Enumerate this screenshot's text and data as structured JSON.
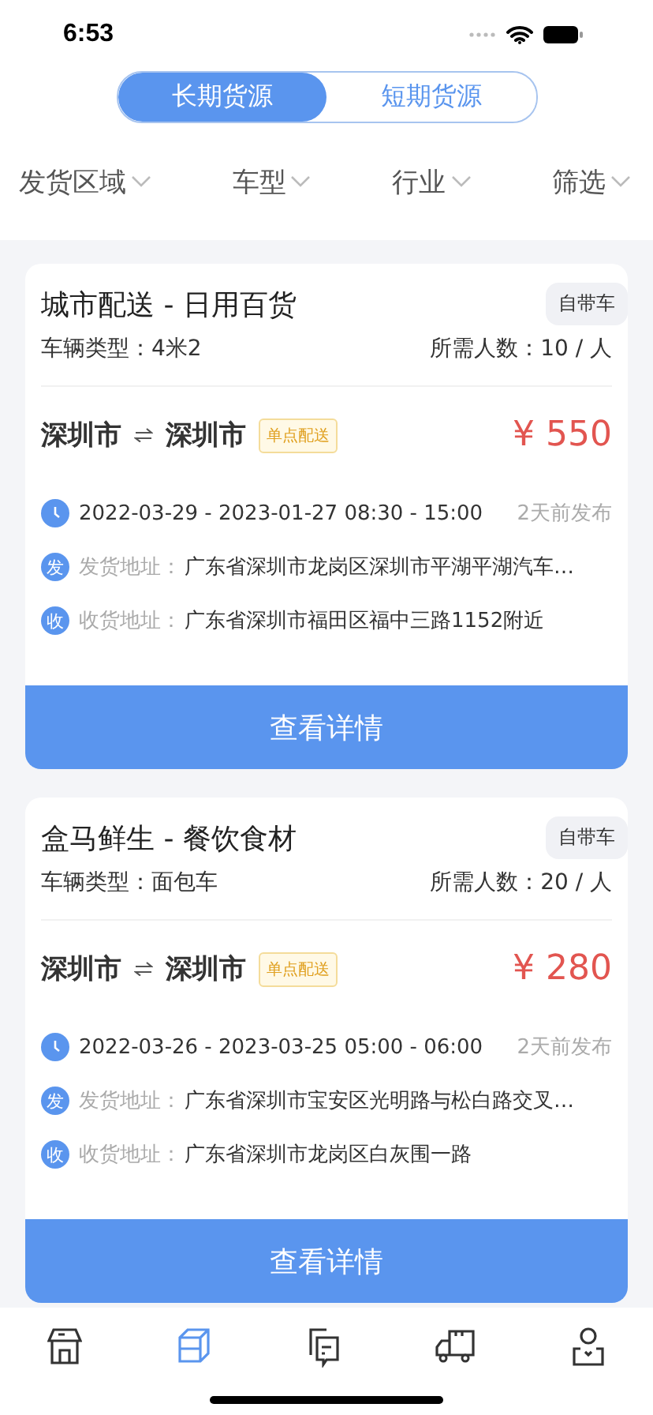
{
  "status_bar": {
    "time": "6:53"
  },
  "segments": [
    {
      "label": "长期货源",
      "selected": true
    },
    {
      "label": "短期货源",
      "selected": false
    }
  ],
  "filters": [
    {
      "label": "发货区域"
    },
    {
      "label": "车型"
    },
    {
      "label": "行业"
    },
    {
      "label": "筛选"
    }
  ],
  "cards": [
    {
      "title": "城市配送 - 日用百货",
      "tag": "自带车",
      "vehicle": "车辆类型：4米2",
      "people": "所需人数：10 / 人",
      "from_city": "深圳市",
      "to_city": "深圳市",
      "badge": "单点配送",
      "price": "¥ 550",
      "schedule": "2022-03-29 - 2023-01-27 08:30 - 15:00",
      "posted": "2天前发布",
      "send_icon": "发",
      "send_label": "发货地址：",
      "send_address": "广东省深圳市龙岗区深圳市平湖平湖汽车…",
      "recv_icon": "收",
      "recv_label": "收货地址：",
      "recv_address": "广东省深圳市福田区福中三路1152附近",
      "button": "查看详情"
    },
    {
      "title": "盒马鲜生 - 餐饮食材",
      "tag": "自带车",
      "vehicle": "车辆类型：面包车",
      "people": "所需人数：20 / 人",
      "from_city": "深圳市",
      "to_city": "深圳市",
      "badge": "单点配送",
      "price": "¥ 280",
      "schedule": "2022-03-26 - 2023-03-25 05:00 - 06:00",
      "posted": "2天前发布",
      "send_icon": "发",
      "send_label": "发货地址：",
      "send_address": "广东省深圳市宝安区光明路与松白路交叉…",
      "recv_icon": "收",
      "recv_label": "收货地址：",
      "recv_address": "广东省深圳市龙岗区白灰围一路",
      "button": "查看详情"
    }
  ],
  "tab_bar": [
    {
      "kind": "store",
      "selected": false
    },
    {
      "kind": "box",
      "selected": true
    },
    {
      "kind": "document",
      "selected": false
    },
    {
      "kind": "truck",
      "selected": false
    },
    {
      "kind": "person",
      "selected": false
    }
  ]
}
